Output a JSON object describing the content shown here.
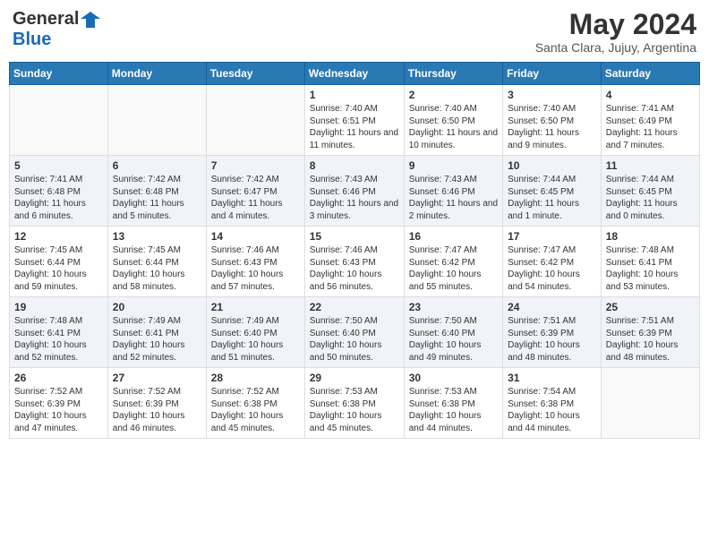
{
  "header": {
    "logo_general": "General",
    "logo_blue": "Blue",
    "month_title": "May 2024",
    "location": "Santa Clara, Jujuy, Argentina"
  },
  "days_of_week": [
    "Sunday",
    "Monday",
    "Tuesday",
    "Wednesday",
    "Thursday",
    "Friday",
    "Saturday"
  ],
  "weeks": [
    [
      {
        "day": "",
        "info": ""
      },
      {
        "day": "",
        "info": ""
      },
      {
        "day": "",
        "info": ""
      },
      {
        "day": "1",
        "info": "Sunrise: 7:40 AM\nSunset: 6:51 PM\nDaylight: 11 hours and 11 minutes."
      },
      {
        "day": "2",
        "info": "Sunrise: 7:40 AM\nSunset: 6:50 PM\nDaylight: 11 hours and 10 minutes."
      },
      {
        "day": "3",
        "info": "Sunrise: 7:40 AM\nSunset: 6:50 PM\nDaylight: 11 hours and 9 minutes."
      },
      {
        "day": "4",
        "info": "Sunrise: 7:41 AM\nSunset: 6:49 PM\nDaylight: 11 hours and 7 minutes."
      }
    ],
    [
      {
        "day": "5",
        "info": "Sunrise: 7:41 AM\nSunset: 6:48 PM\nDaylight: 11 hours and 6 minutes."
      },
      {
        "day": "6",
        "info": "Sunrise: 7:42 AM\nSunset: 6:48 PM\nDaylight: 11 hours and 5 minutes."
      },
      {
        "day": "7",
        "info": "Sunrise: 7:42 AM\nSunset: 6:47 PM\nDaylight: 11 hours and 4 minutes."
      },
      {
        "day": "8",
        "info": "Sunrise: 7:43 AM\nSunset: 6:46 PM\nDaylight: 11 hours and 3 minutes."
      },
      {
        "day": "9",
        "info": "Sunrise: 7:43 AM\nSunset: 6:46 PM\nDaylight: 11 hours and 2 minutes."
      },
      {
        "day": "10",
        "info": "Sunrise: 7:44 AM\nSunset: 6:45 PM\nDaylight: 11 hours and 1 minute."
      },
      {
        "day": "11",
        "info": "Sunrise: 7:44 AM\nSunset: 6:45 PM\nDaylight: 11 hours and 0 minutes."
      }
    ],
    [
      {
        "day": "12",
        "info": "Sunrise: 7:45 AM\nSunset: 6:44 PM\nDaylight: 10 hours and 59 minutes."
      },
      {
        "day": "13",
        "info": "Sunrise: 7:45 AM\nSunset: 6:44 PM\nDaylight: 10 hours and 58 minutes."
      },
      {
        "day": "14",
        "info": "Sunrise: 7:46 AM\nSunset: 6:43 PM\nDaylight: 10 hours and 57 minutes."
      },
      {
        "day": "15",
        "info": "Sunrise: 7:46 AM\nSunset: 6:43 PM\nDaylight: 10 hours and 56 minutes."
      },
      {
        "day": "16",
        "info": "Sunrise: 7:47 AM\nSunset: 6:42 PM\nDaylight: 10 hours and 55 minutes."
      },
      {
        "day": "17",
        "info": "Sunrise: 7:47 AM\nSunset: 6:42 PM\nDaylight: 10 hours and 54 minutes."
      },
      {
        "day": "18",
        "info": "Sunrise: 7:48 AM\nSunset: 6:41 PM\nDaylight: 10 hours and 53 minutes."
      }
    ],
    [
      {
        "day": "19",
        "info": "Sunrise: 7:48 AM\nSunset: 6:41 PM\nDaylight: 10 hours and 52 minutes."
      },
      {
        "day": "20",
        "info": "Sunrise: 7:49 AM\nSunset: 6:41 PM\nDaylight: 10 hours and 52 minutes."
      },
      {
        "day": "21",
        "info": "Sunrise: 7:49 AM\nSunset: 6:40 PM\nDaylight: 10 hours and 51 minutes."
      },
      {
        "day": "22",
        "info": "Sunrise: 7:50 AM\nSunset: 6:40 PM\nDaylight: 10 hours and 50 minutes."
      },
      {
        "day": "23",
        "info": "Sunrise: 7:50 AM\nSunset: 6:40 PM\nDaylight: 10 hours and 49 minutes."
      },
      {
        "day": "24",
        "info": "Sunrise: 7:51 AM\nSunset: 6:39 PM\nDaylight: 10 hours and 48 minutes."
      },
      {
        "day": "25",
        "info": "Sunrise: 7:51 AM\nSunset: 6:39 PM\nDaylight: 10 hours and 48 minutes."
      }
    ],
    [
      {
        "day": "26",
        "info": "Sunrise: 7:52 AM\nSunset: 6:39 PM\nDaylight: 10 hours and 47 minutes."
      },
      {
        "day": "27",
        "info": "Sunrise: 7:52 AM\nSunset: 6:39 PM\nDaylight: 10 hours and 46 minutes."
      },
      {
        "day": "28",
        "info": "Sunrise: 7:52 AM\nSunset: 6:38 PM\nDaylight: 10 hours and 45 minutes."
      },
      {
        "day": "29",
        "info": "Sunrise: 7:53 AM\nSunset: 6:38 PM\nDaylight: 10 hours and 45 minutes."
      },
      {
        "day": "30",
        "info": "Sunrise: 7:53 AM\nSunset: 6:38 PM\nDaylight: 10 hours and 44 minutes."
      },
      {
        "day": "31",
        "info": "Sunrise: 7:54 AM\nSunset: 6:38 PM\nDaylight: 10 hours and 44 minutes."
      },
      {
        "day": "",
        "info": ""
      }
    ]
  ]
}
